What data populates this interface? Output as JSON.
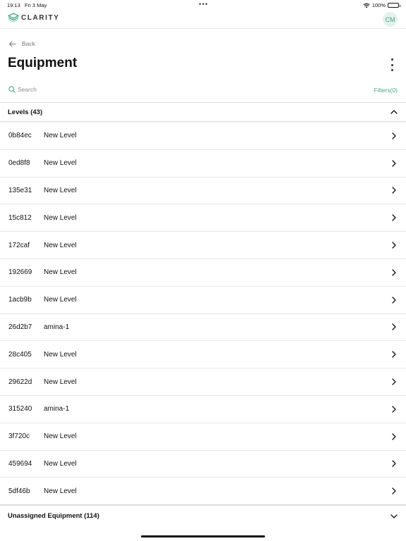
{
  "status_bar": {
    "time": "19:13",
    "date": "Fri 3 May",
    "battery": "100%"
  },
  "header": {
    "logo_text": "CLARITY",
    "avatar_initials": "CM",
    "accent_color": "#4aa58a"
  },
  "nav": {
    "back_label": "Back"
  },
  "page": {
    "title": "Equipment"
  },
  "search": {
    "placeholder": "Search",
    "filters_label": "Filters(0)"
  },
  "levels": {
    "header": "Levels (43)",
    "rows": [
      {
        "code": "0b84ec",
        "name": "New Level"
      },
      {
        "code": "0ed8f8",
        "name": "New Level"
      },
      {
        "code": "135e31",
        "name": "New Level"
      },
      {
        "code": "15c812",
        "name": "New Level"
      },
      {
        "code": "172caf",
        "name": "New Level"
      },
      {
        "code": "192669",
        "name": "New Level"
      },
      {
        "code": "1acb9b",
        "name": "New Level"
      },
      {
        "code": "26d2b7",
        "name": "amina-1"
      },
      {
        "code": "28c405",
        "name": "New Level"
      },
      {
        "code": "29622d",
        "name": "New Level"
      },
      {
        "code": "315240",
        "name": "amina-1"
      },
      {
        "code": "3f720c",
        "name": "New Level"
      },
      {
        "code": "459694",
        "name": "New Level"
      },
      {
        "code": "5df46b",
        "name": "New Level"
      }
    ]
  },
  "unassigned": {
    "header": "Unassigned Equipment (114)"
  }
}
